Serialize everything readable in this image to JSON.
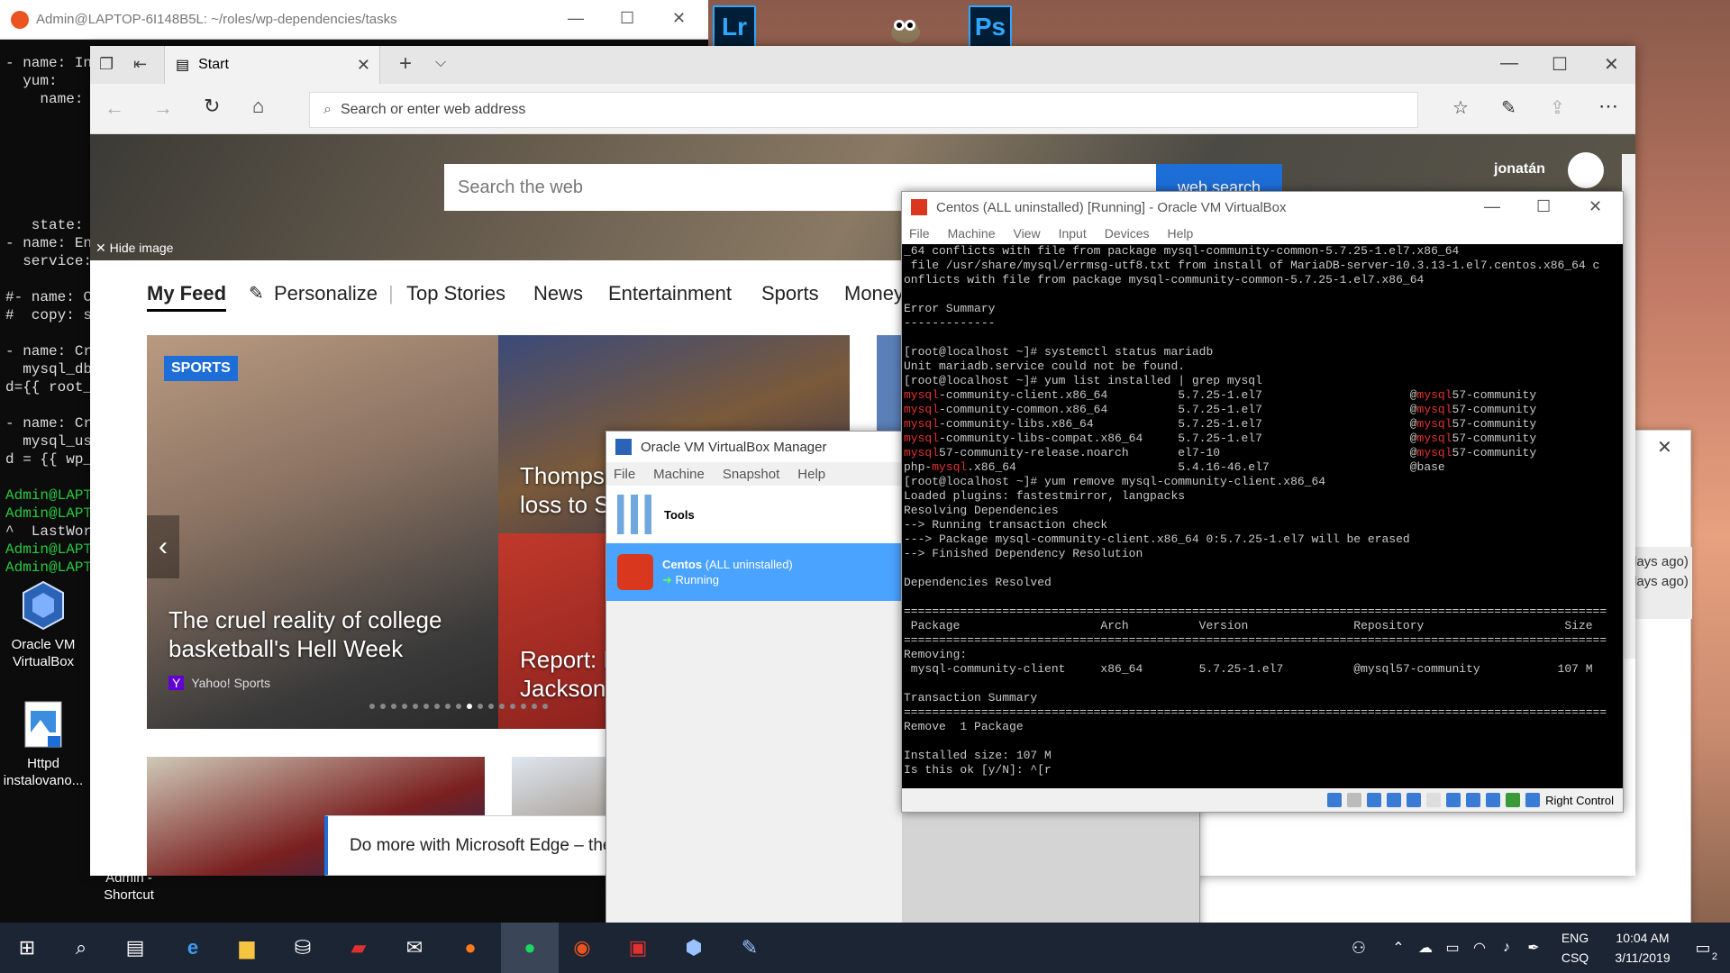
{
  "terminal": {
    "title": "Admin@LAPTOP-6I148B5L: ~/roles/wp-dependencies/tasks",
    "lines": [
      {
        "t": "- name: In",
        "c": ""
      },
      {
        "t": "  yum:",
        "c": ""
      },
      {
        "t": "    name:",
        "c": ""
      },
      {
        "t": "",
        "c": ""
      },
      {
        "t": "",
        "c": ""
      },
      {
        "t": "",
        "c": ""
      },
      {
        "t": "",
        "c": ""
      },
      {
        "t": "",
        "c": ""
      },
      {
        "t": "",
        "c": ""
      },
      {
        "t": "   state:",
        "c": ""
      },
      {
        "t": "- name: Ens",
        "c": ""
      },
      {
        "t": "  service:",
        "c": ""
      },
      {
        "t": "",
        "c": ""
      },
      {
        "t": "#- name: Co",
        "c": ""
      },
      {
        "t": "#  copy: sr",
        "c": ""
      },
      {
        "t": "",
        "c": ""
      },
      {
        "t": "- name: Cre",
        "c": ""
      },
      {
        "t": "  mysql_db",
        "c": ""
      },
      {
        "t": "d={{ root_",
        "c": ""
      },
      {
        "t": "",
        "c": ""
      },
      {
        "t": "- name: Cre",
        "c": ""
      },
      {
        "t": "  mysql_use",
        "c": ""
      },
      {
        "t": "d = {{ wp_",
        "c": ""
      },
      {
        "t": "",
        "c": ""
      },
      {
        "t": "Admin@LAPTO",
        "c": "g"
      },
      {
        "t": "Admin@LAPTO",
        "c": "g"
      },
      {
        "t": "^  LastWork",
        "c": ""
      },
      {
        "t": "Admin@LAPTO",
        "c": "g"
      },
      {
        "t": "Admin@LAPTO",
        "c": "g"
      }
    ]
  },
  "desktop_icons": [
    {
      "label_1": "Oracle VM",
      "label_2": "VirtualBox"
    },
    {
      "label_1": "Httpd",
      "label_2": "instalovano..."
    },
    {
      "label_1": "Admin -",
      "label_2": "Shortcut"
    }
  ],
  "top_apps": {
    "lr": "Lr",
    "ps": "Ps"
  },
  "edge": {
    "tab_title": "Start",
    "address_placeholder": "Search or enter web address",
    "web_search_placeholder": "Search the web",
    "web_search_button": "web search",
    "user_name": "jonatán",
    "hide_image": "Hide image",
    "nav": {
      "my_feed": "My Feed",
      "personalize": "Personalize",
      "top_stories": "Top Stories",
      "news": "News",
      "entertainment": "Entertainment",
      "sports": "Sports",
      "money": "Money"
    },
    "card1": {
      "badge": "SPORTS",
      "headline": "The cruel reality of college basketball's Hell Week",
      "source": "Yahoo! Sports"
    },
    "card2": {
      "headline_1": "Thompso",
      "headline_2": "loss to Su"
    },
    "card3": {
      "headline_1": "Report: B",
      "headline_2": "Jackson"
    },
    "promo": "Do more with Microsoft Edge – the"
  },
  "vbox_manager": {
    "title": "Oracle VM VirtualBox Manager",
    "menu": [
      "File",
      "Machine",
      "Snapshot",
      "Help"
    ],
    "tools": "Tools",
    "vm_name": "Centos",
    "vm_state_note": "(ALL uninstalled)",
    "vm_status": "Running"
  },
  "vm_window": {
    "title": "Centos (ALL uninstalled) [Running] - Oracle VM VirtualBox",
    "menu": [
      "File",
      "Machine",
      "View",
      "Input",
      "Devices",
      "Help"
    ],
    "right_control": "Right Control",
    "console": [
      {
        "t": "_64 conflicts with file from package mysql-community-common-5.7.25-1.el7.x86_64"
      },
      {
        "t": " file /usr/share/mysql/errmsg-utf8.txt from install of MariaDB-server-10.3.13-1.el7.centos.x86_64 c"
      },
      {
        "t": "onflicts with file from package mysql-community-common-5.7.25-1.el7.x86_64"
      },
      {
        "t": ""
      },
      {
        "t": "Error Summary"
      },
      {
        "t": "-------------"
      },
      {
        "t": ""
      },
      {
        "t": "[root@localhost ~]# systemctl status mariadb"
      },
      {
        "t": "Unit mariadb.service could not be found."
      },
      {
        "t": "[root@localhost ~]# yum list installed | grep mysql"
      },
      {
        "r": "mysql",
        "t": "-community-client.x86_64          5.7.25-1.el7                     @",
        "r2": "mysql",
        "t2": "57-community"
      },
      {
        "r": "mysql",
        "t": "-community-common.x86_64          5.7.25-1.el7                     @",
        "r2": "mysql",
        "t2": "57-community"
      },
      {
        "r": "mysql",
        "t": "-community-libs.x86_64            5.7.25-1.el7                     @",
        "r2": "mysql",
        "t2": "57-community"
      },
      {
        "r": "mysql",
        "t": "-community-libs-compat.x86_64     5.7.25-1.el7                     @",
        "r2": "mysql",
        "t2": "57-community"
      },
      {
        "r": "mysql",
        "t": "57-community-release.noarch       el7-10                           @",
        "r2": "mysql",
        "t2": "57-community"
      },
      {
        "p": "php-",
        "r": "mysql",
        "t": ".x86_64                       5.4.16-46.el7                    @base"
      },
      {
        "t": "[root@localhost ~]# yum remove mysql-community-client.x86_64"
      },
      {
        "t": "Loaded plugins: fastestmirror, langpacks"
      },
      {
        "t": "Resolving Dependencies"
      },
      {
        "t": "--> Running transaction check"
      },
      {
        "t": "---> Package mysql-community-client.x86_64 0:5.7.25-1.el7 will be erased"
      },
      {
        "t": "--> Finished Dependency Resolution"
      },
      {
        "t": ""
      },
      {
        "t": "Dependencies Resolved"
      },
      {
        "t": ""
      },
      {
        "t": "===================================================================================================="
      },
      {
        "t": " Package                    Arch          Version               Repository                    Size"
      },
      {
        "t": "===================================================================================================="
      },
      {
        "t": "Removing:"
      },
      {
        "t": " mysql-community-client     x86_64        5.7.25-1.el7          @mysql57-community           107 M"
      },
      {
        "t": ""
      },
      {
        "t": "Transaction Summary"
      },
      {
        "t": "===================================================================================================="
      },
      {
        "t": "Remove  1 Package"
      },
      {
        "t": ""
      },
      {
        "t": "Installed size: 107 M"
      },
      {
        "t": "Is this ok [y/N]: ^[r"
      }
    ]
  },
  "bg_dialog": {
    "line1": "days ago)",
    "line2": "days ago)"
  },
  "taskbar": {
    "lang_1": "ENG",
    "lang_2": "CSQ",
    "time": "10:04 AM",
    "date": "3/11/2019",
    "notif_count": "2"
  },
  "colors": {
    "taskbar": "#1c2533",
    "selection": "#4aa3ff",
    "accent": "#1e6ed8"
  }
}
